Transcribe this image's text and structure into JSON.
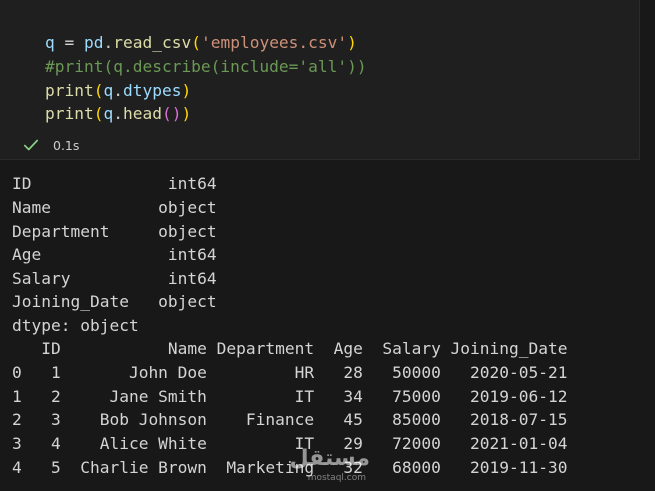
{
  "cell": {
    "code_lines": [
      [
        {
          "t": "q",
          "c": "tok-var"
        },
        {
          "t": " = ",
          "c": "tok-op"
        },
        {
          "t": "pd",
          "c": "tok-var"
        },
        {
          "t": ".",
          "c": "tok-pun"
        },
        {
          "t": "read_csv",
          "c": "tok-fn"
        },
        {
          "t": "(",
          "c": "br1"
        },
        {
          "t": "'employees.csv'",
          "c": "tok-str"
        },
        {
          "t": ")",
          "c": "br1"
        }
      ],
      [
        {
          "t": "#print(q.describe(include='all'))",
          "c": "tok-com"
        }
      ],
      [
        {
          "t": "print",
          "c": "tok-fn"
        },
        {
          "t": "(",
          "c": "br1"
        },
        {
          "t": "q",
          "c": "tok-var"
        },
        {
          "t": ".",
          "c": "tok-pun"
        },
        {
          "t": "dtypes",
          "c": "tok-var"
        },
        {
          "t": ")",
          "c": "br1"
        }
      ],
      [
        {
          "t": "print",
          "c": "tok-fn"
        },
        {
          "t": "(",
          "c": "br1"
        },
        {
          "t": "q",
          "c": "tok-var"
        },
        {
          "t": ".",
          "c": "tok-pun"
        },
        {
          "t": "head",
          "c": "tok-fn"
        },
        {
          "t": "()",
          "c": "br2"
        },
        {
          "t": ")",
          "c": "br1"
        }
      ]
    ],
    "status": {
      "icon": "check-icon",
      "time": "0.1s",
      "color": "#89d185"
    }
  },
  "output": {
    "dtypes_lines": [
      "ID              int64",
      "Name           object",
      "Department     object",
      "Age             int64",
      "Salary          int64",
      "Joining_Date   object",
      "dtype: object"
    ],
    "head_header": "   ID           Name Department  Age  Salary Joining_Date",
    "head_rows": [
      "0   1       John Doe         HR   28   50000   2020-05-21",
      "1   2     Jane Smith         IT   34   75000   2019-06-12",
      "2   3    Bob Johnson    Finance   45   85000   2018-07-15",
      "3   4    Alice White         IT   29   72000   2021-01-04",
      "4   5  Charlie Brown  Marketing   32   68000   2019-11-30"
    ]
  },
  "watermark": {
    "text": "مستقل",
    "url": "mostaql.com"
  }
}
